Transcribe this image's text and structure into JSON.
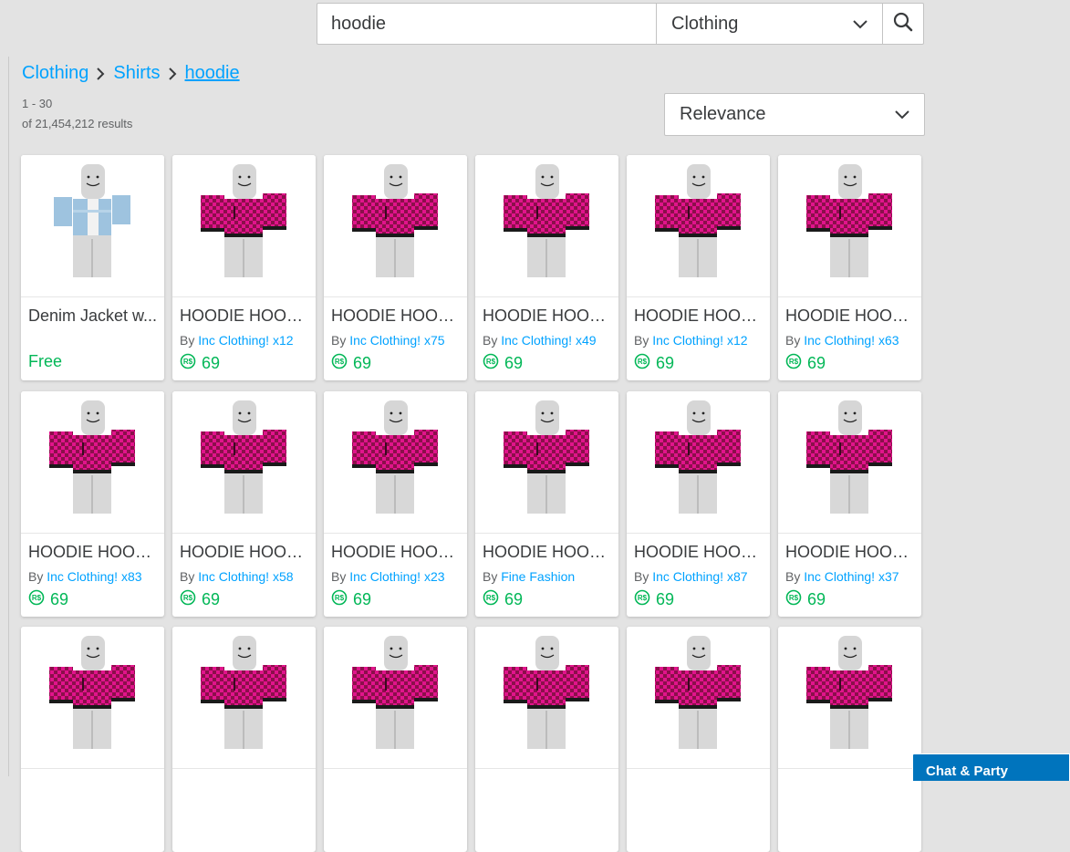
{
  "search": {
    "query": "hoodie",
    "category": "Clothing"
  },
  "breadcrumb": [
    "Clothing",
    "Shirts",
    "hoodie"
  ],
  "results": {
    "range": "1 - 30",
    "total": "of 21,454,212 results"
  },
  "sort": {
    "selected": "Relevance"
  },
  "items": [
    {
      "name": "Denim Jacket w...",
      "by": "",
      "creator": "",
      "price": "Free",
      "free": true,
      "style": "denim"
    },
    {
      "name": "HOODIE HOODI...",
      "by": "By",
      "creator": "Inc Clothing! x12",
      "price": "69",
      "free": false,
      "style": "hoodie"
    },
    {
      "name": "HOODIE HOODI...",
      "by": "By",
      "creator": "Inc Clothing! x75",
      "price": "69",
      "free": false,
      "style": "hoodie"
    },
    {
      "name": "HOODIE HOODI...",
      "by": "By",
      "creator": "Inc Clothing! x49",
      "price": "69",
      "free": false,
      "style": "hoodie"
    },
    {
      "name": "HOODIE HOODI...",
      "by": "By",
      "creator": "Inc Clothing! x12",
      "price": "69",
      "free": false,
      "style": "hoodie"
    },
    {
      "name": "HOODIE HOODI...",
      "by": "By",
      "creator": "Inc Clothing! x63",
      "price": "69",
      "free": false,
      "style": "hoodie"
    },
    {
      "name": "HOODIE HOODI...",
      "by": "By",
      "creator": "Inc Clothing! x83",
      "price": "69",
      "free": false,
      "style": "hoodie"
    },
    {
      "name": "HOODIE HOODI...",
      "by": "By",
      "creator": "Inc Clothing! x58",
      "price": "69",
      "free": false,
      "style": "hoodie"
    },
    {
      "name": "HOODIE HOODI...",
      "by": "By",
      "creator": "Inc Clothing! x23",
      "price": "69",
      "free": false,
      "style": "hoodie"
    },
    {
      "name": "HOODIE HOODI...",
      "by": "By",
      "creator": "Fine Fashion",
      "price": "69",
      "free": false,
      "style": "hoodie"
    },
    {
      "name": "HOODIE HOODI...",
      "by": "By",
      "creator": "Inc Clothing! x87",
      "price": "69",
      "free": false,
      "style": "hoodie"
    },
    {
      "name": "HOODIE HOODI...",
      "by": "By",
      "creator": "Inc Clothing! x37",
      "price": "69",
      "free": false,
      "style": "hoodie"
    },
    {
      "name": "",
      "by": "",
      "creator": "",
      "price": "",
      "free": false,
      "style": "hoodie"
    },
    {
      "name": "",
      "by": "",
      "creator": "",
      "price": "",
      "free": false,
      "style": "hoodie"
    },
    {
      "name": "",
      "by": "",
      "creator": "",
      "price": "",
      "free": false,
      "style": "hoodie"
    },
    {
      "name": "",
      "by": "",
      "creator": "",
      "price": "",
      "free": false,
      "style": "hoodie"
    },
    {
      "name": "",
      "by": "",
      "creator": "",
      "price": "",
      "free": false,
      "style": "hoodie"
    },
    {
      "name": "",
      "by": "",
      "creator": "",
      "price": "",
      "free": false,
      "style": "hoodie"
    }
  ],
  "chat": {
    "label": "Chat & Party"
  },
  "colors": {
    "link": "#00a2ff",
    "price": "#02b757",
    "hoodie_dark": "#8b0f4a",
    "hoodie_bright": "#e1148c",
    "denim": "#9ec3df"
  },
  "icons": {
    "search": "magnifier-icon",
    "dropdown": "chevron-down-icon",
    "breadcrumb_sep": "chevron-right-icon",
    "currency": "robux-icon"
  }
}
